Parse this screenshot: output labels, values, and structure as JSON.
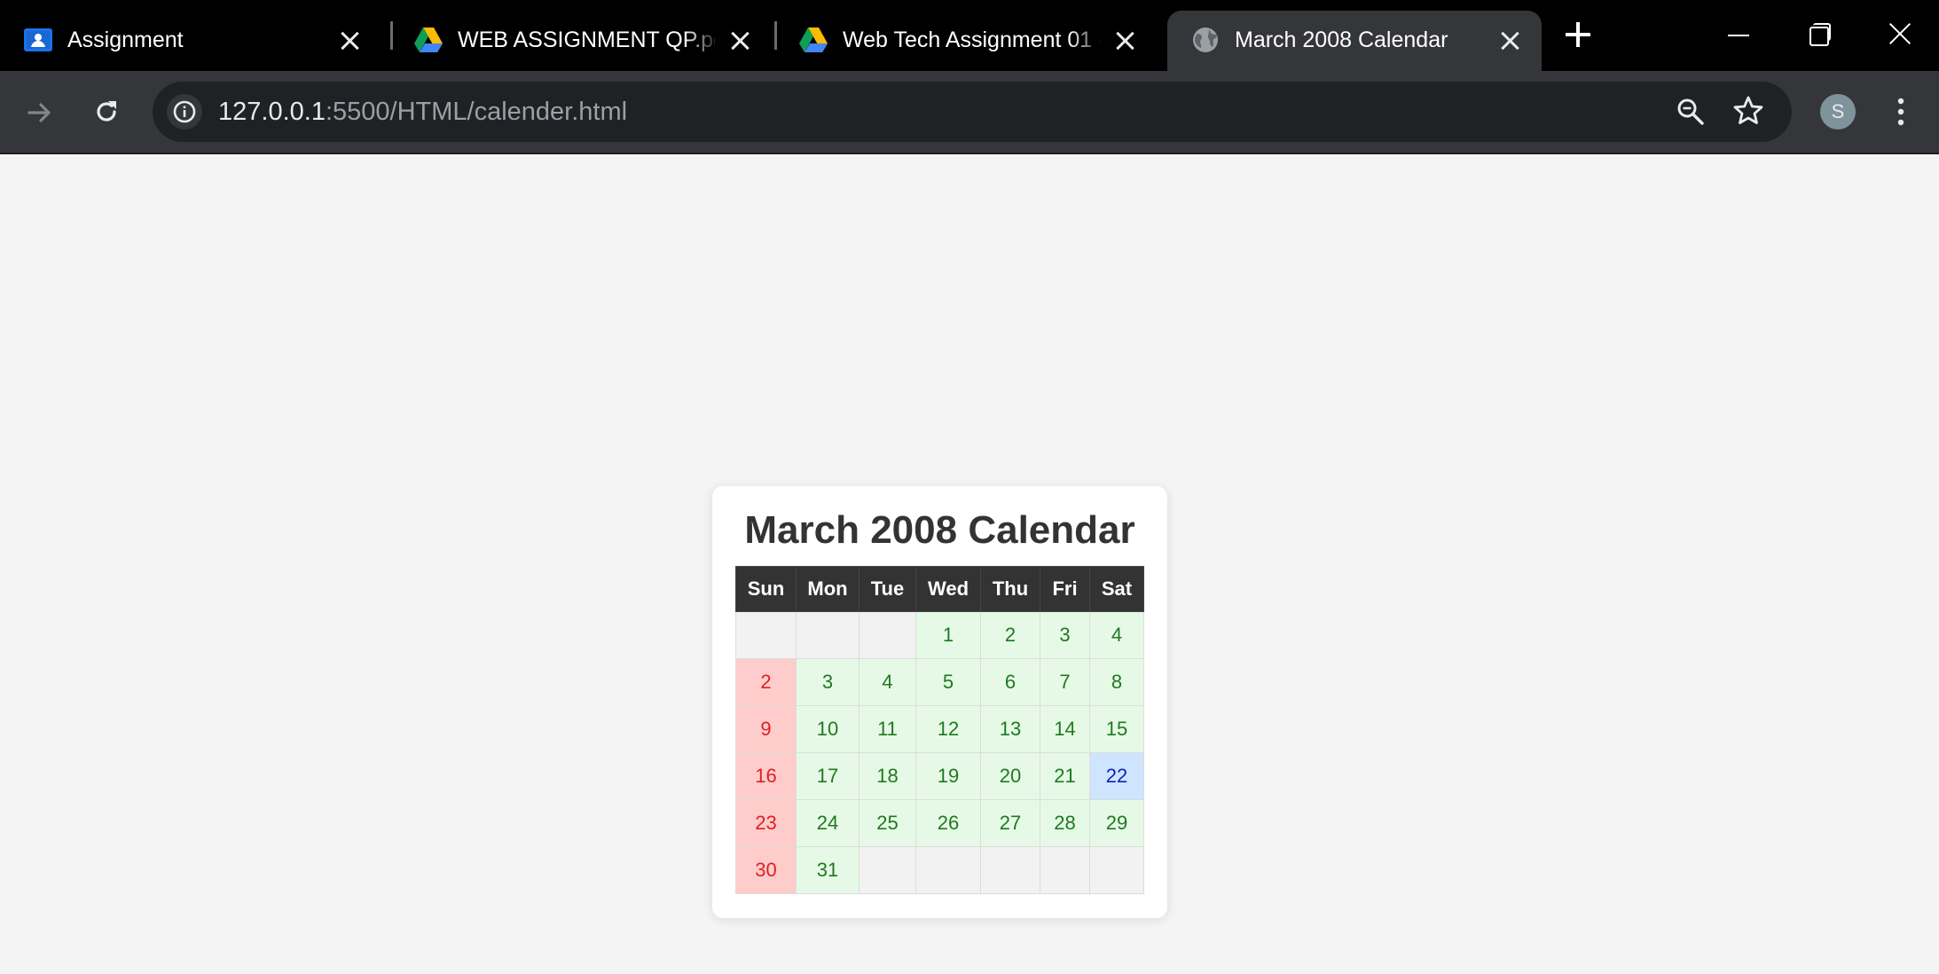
{
  "tabs": [
    {
      "title": "Assignment",
      "icon": "classroom-icon"
    },
    {
      "title": "WEB ASSIGNMENT QP.pdf - Google Drive",
      "icon": "google-drive-icon"
    },
    {
      "title": "Web Tech Assignment 01 - Google Drive",
      "icon": "google-drive-icon"
    },
    {
      "title": "March 2008 Calendar",
      "icon": "globe-icon",
      "active": true
    }
  ],
  "address_bar": {
    "host": "127.0.0.1",
    "rest": ":5500/HTML/calender.html"
  },
  "profile": {
    "initial": "S"
  },
  "calendar": {
    "title": "March 2008 Calendar",
    "weekdays": [
      "Sun",
      "Mon",
      "Tue",
      "Wed",
      "Thu",
      "Fri",
      "Sat"
    ],
    "weeks": [
      [
        "",
        "",
        "",
        "1",
        "2",
        "3",
        "4"
      ],
      [
        "2",
        "3",
        "4",
        "5",
        "6",
        "7",
        "8"
      ],
      [
        "9",
        "10",
        "11",
        "12",
        "13",
        "14",
        "15"
      ],
      [
        "16",
        "17",
        "18",
        "19",
        "20",
        "21",
        "22"
      ],
      [
        "23",
        "24",
        "25",
        "26",
        "27",
        "28",
        "29"
      ],
      [
        "30",
        "31",
        "",
        "",
        "",
        "",
        ""
      ]
    ],
    "highlighted": "22"
  },
  "colors": {
    "header_bg": "#333333",
    "day_cell_bg": "#e6f9e6",
    "day_text": "#1f7a1f",
    "sunday_bg": "#ffcccc",
    "sunday_text": "#e02020",
    "highlight_bg": "#cfe5ff",
    "highlight_text": "#1020c0",
    "empty_bg": "#f2f2f2"
  }
}
